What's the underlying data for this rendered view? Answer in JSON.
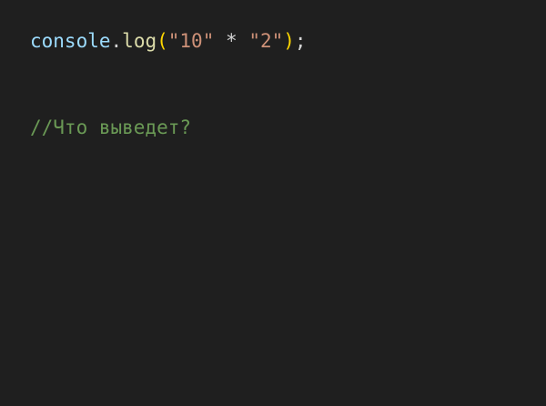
{
  "colors": {
    "background": "#1f1f1f",
    "identifier": "#9cdcfe",
    "function": "#dcdcaa",
    "paren": "#ffd700",
    "string": "#ce9178",
    "punctuation": "#d4d4d4",
    "comment": "#6a9955"
  },
  "code": {
    "line1": {
      "object": "console",
      "dot": ".",
      "method": "log",
      "open_paren": "(",
      "string_a": "\"10\"",
      "space_1": " ",
      "operator": "*",
      "space_2": " ",
      "string_b": "\"2\"",
      "close_paren": ")",
      "semicolon": ";"
    },
    "line2": {
      "comment": "//Что выведет?"
    }
  }
}
